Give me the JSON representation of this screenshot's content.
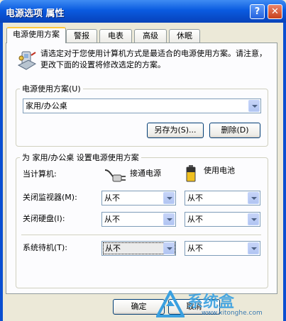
{
  "window": {
    "title": "电源选项 属性",
    "help": "?",
    "close": "✕"
  },
  "tabs": [
    {
      "label": "电源使用方案"
    },
    {
      "label": "警报"
    },
    {
      "label": "电表"
    },
    {
      "label": "高级"
    },
    {
      "label": "休眠"
    }
  ],
  "description": "请选定对于您使用计算机方式是最适合的电源使用方案。请注意，更改下面的设置将修改选定的方案。",
  "scheme_group": {
    "legend": "电源使用方案(U)",
    "selected": "家用/办公桌",
    "save_as": "另存为(S)...",
    "delete": "删除(D)"
  },
  "settings_group": {
    "legend": "为 家用/办公桌 设置电源使用方案",
    "when_computer": "当计算机:",
    "col_plugged": "接通电源",
    "col_battery": "使用电池",
    "rows": [
      {
        "label": "关闭监视器(M):",
        "plugged": "从不",
        "battery": "从不"
      },
      {
        "label": "关闭硬盘(I):",
        "plugged": "从不",
        "battery": "从不"
      },
      {
        "label": "系统待机(T):",
        "plugged": "从不",
        "battery": "从不"
      }
    ]
  },
  "footer": {
    "ok": "确定",
    "cancel": "取消"
  },
  "watermark": {
    "text": "系统盒",
    "url": "www.xitonghe.com",
    "color": "#3aa0e0"
  }
}
